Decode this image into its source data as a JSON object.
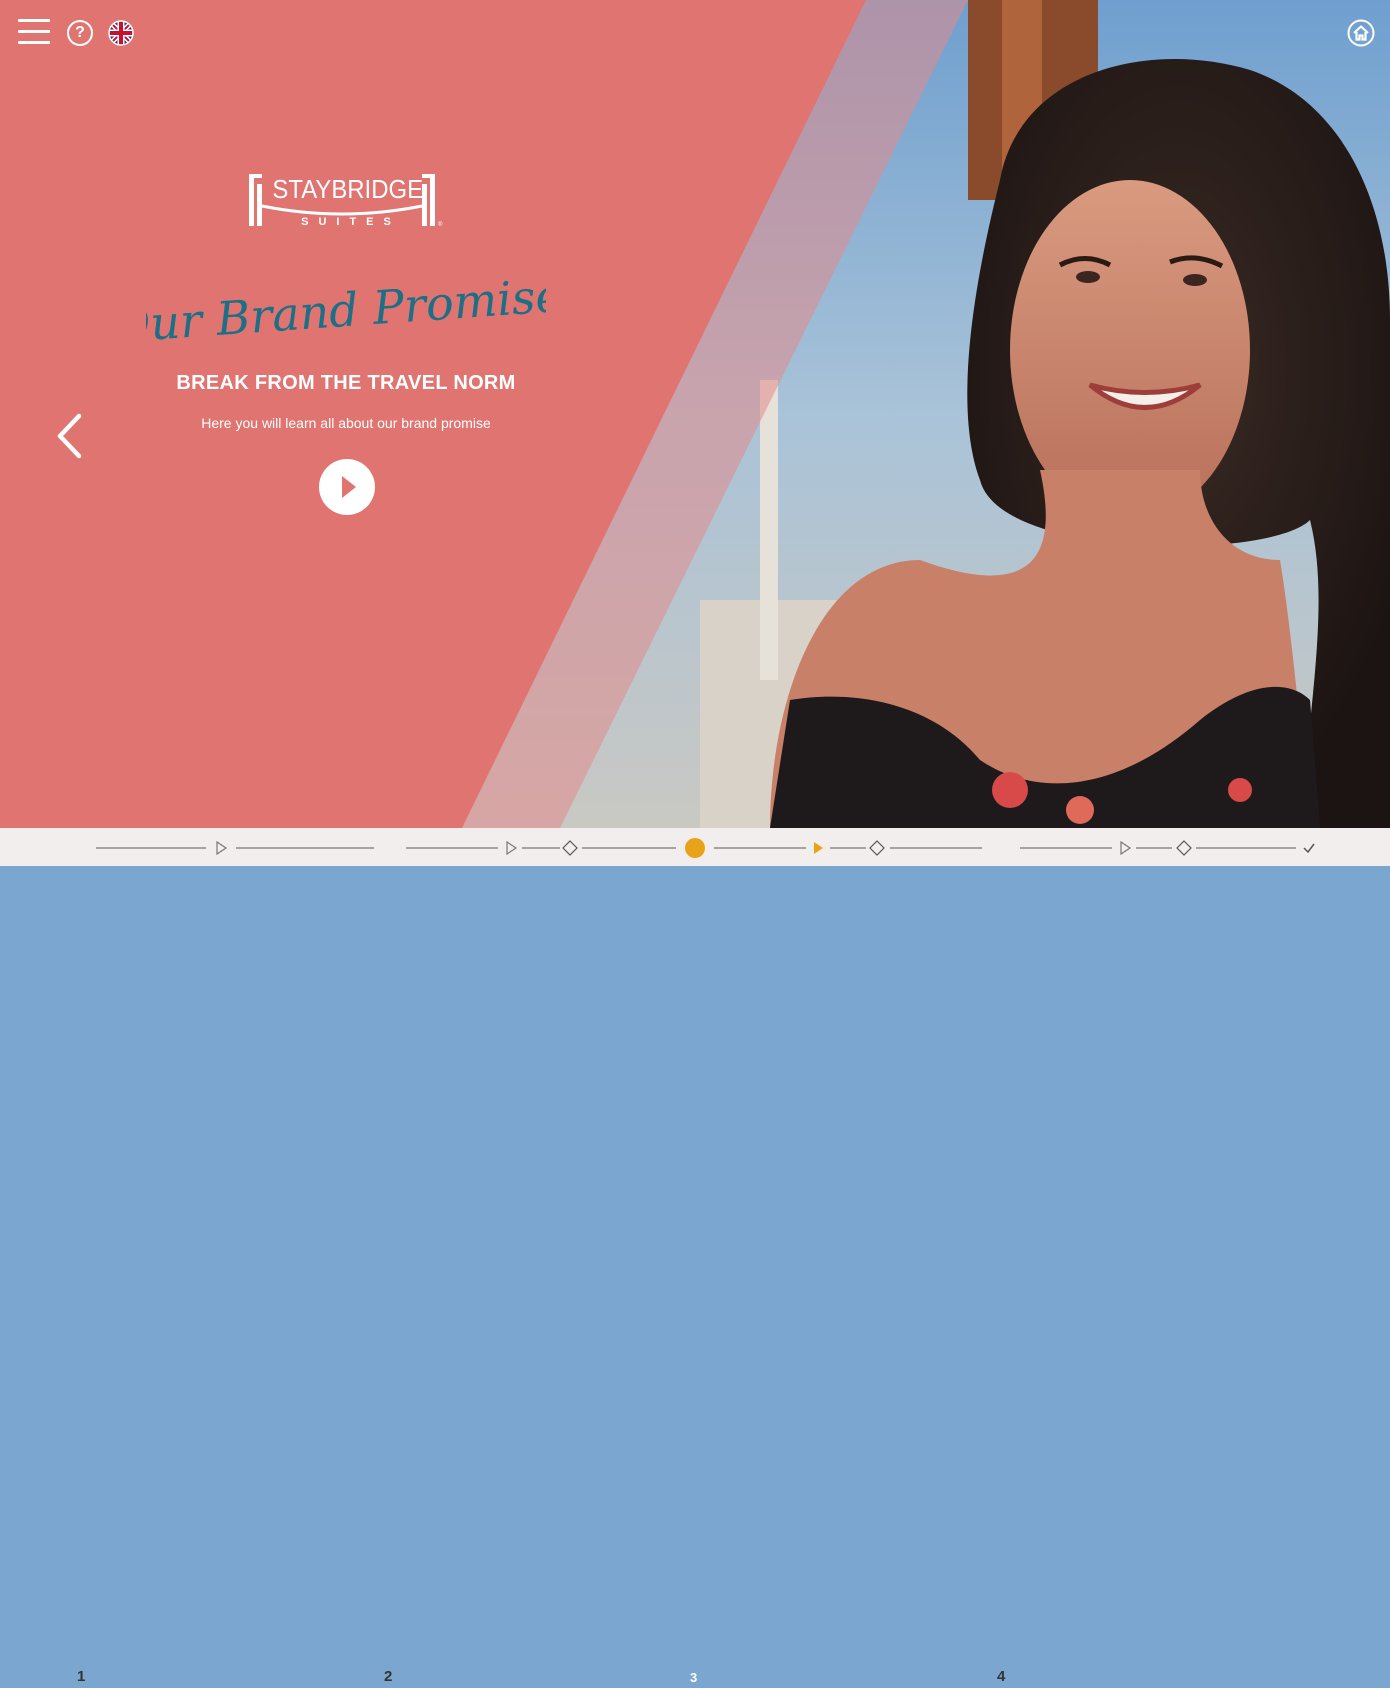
{
  "header": {
    "menu_icon": "hamburger-menu-icon",
    "help_label": "?",
    "language_icon": "uk-flag-icon",
    "home_icon": "home-icon"
  },
  "logo": {
    "word": "STAYBRIDGE",
    "sub": "SUITES"
  },
  "hero": {
    "script_title": "Our Brand Promise:",
    "tagline": "BREAK FROM THE TRAVEL NORM",
    "description": "Here you will learn all about our brand promise",
    "play_icon": "play-icon",
    "prev_icon": "chevron-left-icon"
  },
  "progress": {
    "steps": [
      "1",
      "2",
      "3",
      "4"
    ],
    "current_step": "3",
    "current_color": "#e8a31a"
  },
  "colors": {
    "coral": "#e07570",
    "script_teal": "#1b6f86"
  }
}
